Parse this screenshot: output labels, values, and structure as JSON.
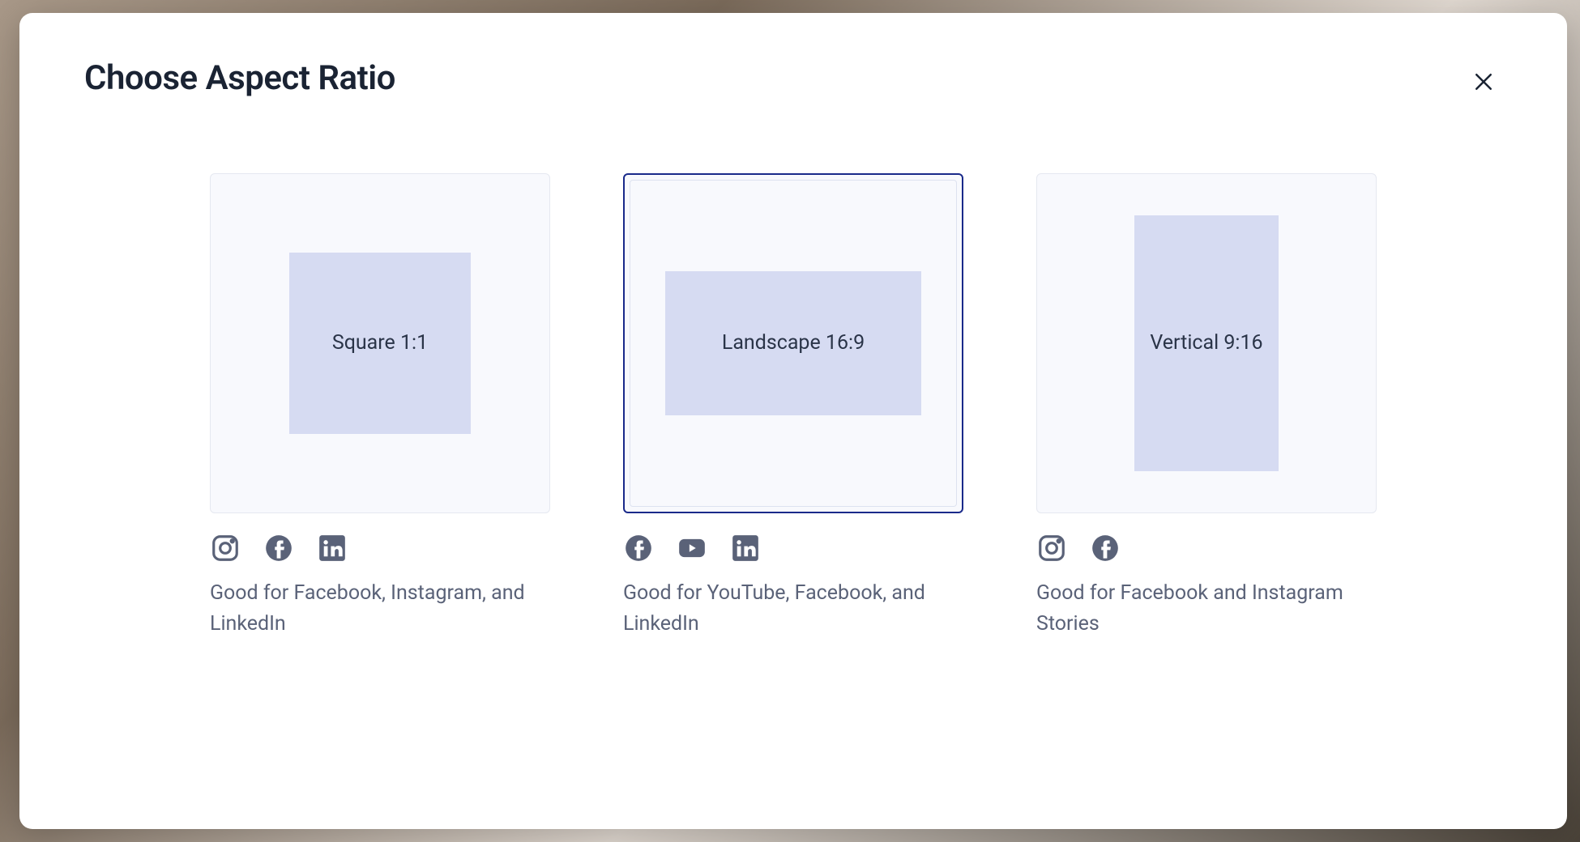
{
  "modal": {
    "title": "Choose Aspect Ratio"
  },
  "options": [
    {
      "label": "Square 1:1",
      "caption": "Good for Facebook, Instagram, and LinkedIn",
      "selected": false,
      "shape": "square",
      "icons": [
        "instagram",
        "facebook",
        "linkedin"
      ]
    },
    {
      "label": "Landscape 16:9",
      "caption": "Good for YouTube, Facebook, and LinkedIn",
      "selected": true,
      "shape": "landscape",
      "icons": [
        "facebook",
        "youtube",
        "linkedin"
      ]
    },
    {
      "label": "Vertical 9:16",
      "caption": "Good for Facebook and Instagram Stories",
      "selected": false,
      "shape": "vertical",
      "icons": [
        "instagram",
        "facebook"
      ]
    }
  ]
}
